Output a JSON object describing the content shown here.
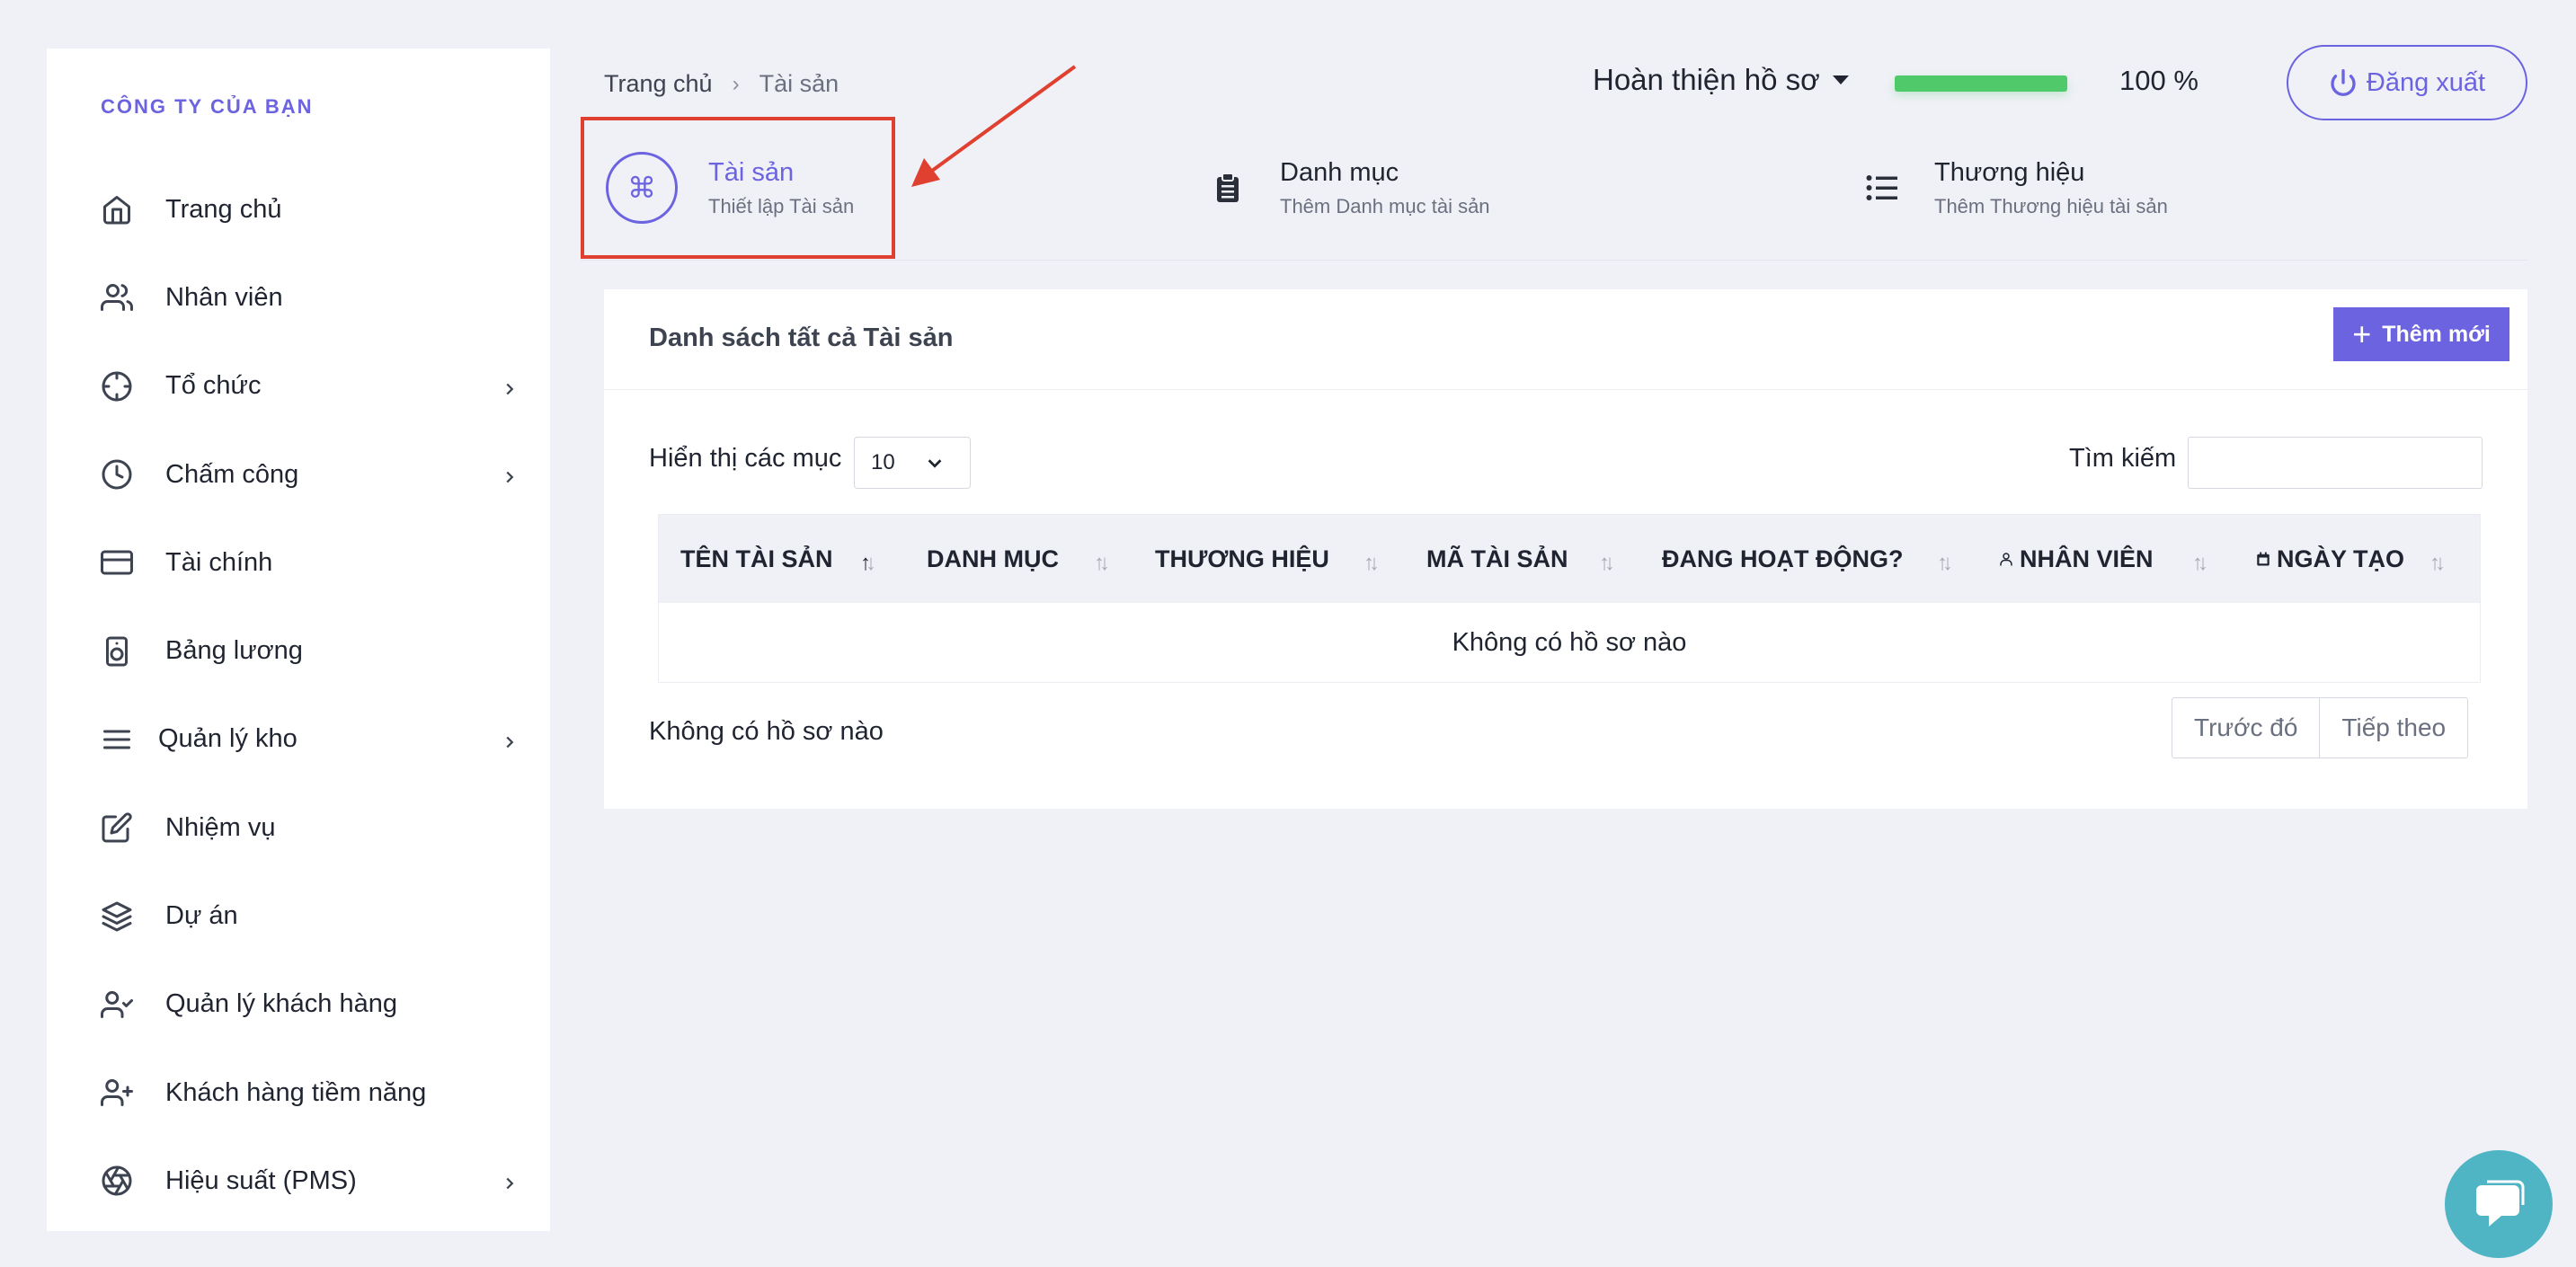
{
  "sidebar": {
    "company": "CÔNG TY CỦA BẠN",
    "items": [
      {
        "label": "Trang chủ",
        "icon": "home-icon",
        "has_children": false
      },
      {
        "label": "Nhân viên",
        "icon": "users-icon",
        "has_children": false
      },
      {
        "label": "Tổ chức",
        "icon": "crosshair-icon",
        "has_children": true
      },
      {
        "label": "Chấm công",
        "icon": "clock-icon",
        "has_children": true
      },
      {
        "label": "Tài chính",
        "icon": "credit-card-icon",
        "has_children": false
      },
      {
        "label": "Bảng lương",
        "icon": "speaker-icon",
        "has_children": false
      },
      {
        "label": "Quản lý kho",
        "icon": "menu-lines-icon",
        "has_children": true
      },
      {
        "label": "Nhiệm vụ",
        "icon": "edit-icon",
        "has_children": false
      },
      {
        "label": "Dự án",
        "icon": "layers-icon",
        "has_children": false
      },
      {
        "label": "Quản lý khách hàng",
        "icon": "user-check-icon",
        "has_children": false
      },
      {
        "label": "Khách hàng tiềm năng",
        "icon": "user-plus-icon",
        "has_children": false
      },
      {
        "label": "Hiệu suất (PMS)",
        "icon": "aperture-icon",
        "has_children": true
      }
    ]
  },
  "breadcrumb": {
    "home": "Trang chủ",
    "separator": "›",
    "current": "Tài sản"
  },
  "header": {
    "profile_label": "Hoàn thiện hồ sơ",
    "progress_fraction": 1.0,
    "progress_label": "100 %",
    "logout_label": "Đăng xuất",
    "accent_color": "#6c63e0",
    "progress_color": "#4fc96a"
  },
  "tabs": [
    {
      "title": "Tài sản",
      "subtitle": "Thiết lập Tài sản",
      "icon": "command-icon",
      "active": true
    },
    {
      "title": "Danh mục",
      "subtitle": "Thêm Danh mục tài sản",
      "icon": "clipboard-icon",
      "active": false
    },
    {
      "title": "Thương hiệu",
      "subtitle": "Thêm Thương hiệu tài sản",
      "icon": "list-icon",
      "active": false
    }
  ],
  "card": {
    "title": "Danh sách tất cả Tài sản",
    "add_label": "Thêm mới",
    "length_label": "Hiển thị các mục",
    "length_value": "10",
    "search_label": "Tìm kiếm",
    "search_value": "",
    "columns": [
      "TÊN TÀI SẢN",
      "DANH MỤC",
      "THƯƠNG HIỆU",
      "MÃ TÀI SẢN",
      "ĐANG HOẠT ĐỘNG?",
      "NHÂN VIÊN",
      "NGÀY TẠO"
    ],
    "empty_text": "Không có hồ sơ nào",
    "info_text": "Không có hồ sơ nào",
    "prev_label": "Trước đó",
    "next_label": "Tiếp theo"
  }
}
